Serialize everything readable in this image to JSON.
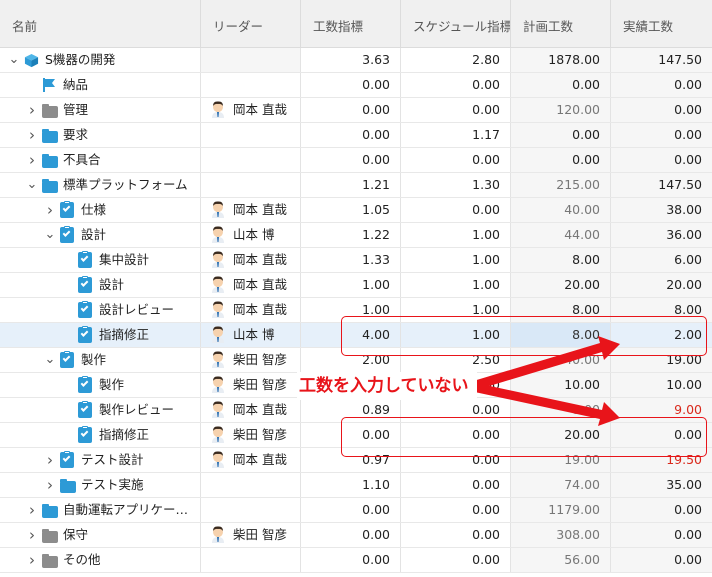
{
  "columns": {
    "name": "名前",
    "leader": "リーダー",
    "kosu_index": "工数指標",
    "schedule_index": "スケジュール指標",
    "planned": "計画工数",
    "actual": "実績工数"
  },
  "rows": [
    {
      "name": "S機器の開発",
      "icon": "package-icon",
      "toggle": "expanded",
      "leader": "",
      "kosu": "3.63",
      "schedule": "2.80",
      "planned": "1878.00",
      "actual": "147.50"
    },
    {
      "name": "納品",
      "icon": "flag-icon",
      "toggle": "",
      "leader": "",
      "kosu": "0.00",
      "schedule": "0.00",
      "planned": "0.00",
      "actual": "0.00"
    },
    {
      "name": "管理",
      "icon": "folder-gray-icon",
      "toggle": "collapsed",
      "leader": "岡本 直哉",
      "kosu": "0.00",
      "schedule": "0.00",
      "planned": "120.00",
      "actual": "0.00"
    },
    {
      "name": "要求",
      "icon": "folder-blue-icon",
      "toggle": "collapsed",
      "leader": "",
      "kosu": "0.00",
      "schedule": "1.17",
      "planned": "0.00",
      "actual": "0.00"
    },
    {
      "name": "不具合",
      "icon": "folder-blue-icon",
      "toggle": "collapsed",
      "leader": "",
      "kosu": "0.00",
      "schedule": "0.00",
      "planned": "0.00",
      "actual": "0.00"
    },
    {
      "name": "標準プラットフォーム",
      "icon": "folder-blue-icon",
      "toggle": "expanded",
      "leader": "",
      "kosu": "1.21",
      "schedule": "1.30",
      "planned": "215.00",
      "actual": "147.50"
    },
    {
      "name": "仕様",
      "icon": "task-icon",
      "toggle": "collapsed",
      "leader": "岡本 直哉",
      "kosu": "1.05",
      "schedule": "0.00",
      "planned": "40.00",
      "actual": "38.00"
    },
    {
      "name": "設計",
      "icon": "task-icon",
      "toggle": "expanded",
      "leader": "山本 博",
      "kosu": "1.22",
      "schedule": "1.00",
      "planned": "44.00",
      "actual": "36.00"
    },
    {
      "name": "集中設計",
      "icon": "task-icon",
      "toggle": "",
      "leader": "岡本 直哉",
      "kosu": "1.33",
      "schedule": "1.00",
      "planned": "8.00",
      "actual": "6.00"
    },
    {
      "name": "設計",
      "icon": "task-icon",
      "toggle": "",
      "leader": "岡本 直哉",
      "kosu": "1.00",
      "schedule": "1.00",
      "planned": "20.00",
      "actual": "20.00"
    },
    {
      "name": "設計レビュー",
      "icon": "task-icon",
      "toggle": "",
      "leader": "岡本 直哉",
      "kosu": "1.00",
      "schedule": "1.00",
      "planned": "8.00",
      "actual": "8.00"
    },
    {
      "name": "指摘修正",
      "icon": "task-icon",
      "toggle": "",
      "leader": "山本 博",
      "kosu": "4.00",
      "schedule": "1.00",
      "planned": "8.00",
      "actual": "2.00"
    },
    {
      "name": "製作",
      "icon": "task-icon",
      "toggle": "expanded",
      "leader": "柴田 智彦",
      "kosu": "2.00",
      "schedule": "2.50",
      "planned": "40.00",
      "actual": "19.00"
    },
    {
      "name": "製作",
      "icon": "task-icon",
      "toggle": "",
      "leader": "柴田 智彦",
      "kosu": "1.00",
      "schedule": "1.00",
      "planned": "10.00",
      "actual": "10.00"
    },
    {
      "name": "製作レビュー",
      "icon": "task-icon",
      "toggle": "",
      "leader": "岡本 直哉",
      "kosu": "0.89",
      "schedule": "0.00",
      "planned": "8.00",
      "actual": "9.00"
    },
    {
      "name": "指摘修正",
      "icon": "task-icon",
      "toggle": "",
      "leader": "柴田 智彦",
      "kosu": "0.00",
      "schedule": "0.00",
      "planned": "20.00",
      "actual": "0.00"
    },
    {
      "name": "テスト設計",
      "icon": "task-icon",
      "toggle": "collapsed",
      "leader": "岡本 直哉",
      "kosu": "0.97",
      "schedule": "0.00",
      "planned": "19.00",
      "actual": "19.50"
    },
    {
      "name": "テスト実施",
      "icon": "folder-blue-icon",
      "toggle": "collapsed",
      "leader": "",
      "kosu": "1.10",
      "schedule": "0.00",
      "planned": "74.00",
      "actual": "35.00"
    },
    {
      "name": "自動運転アプリケー…",
      "icon": "folder-blue-icon",
      "toggle": "collapsed",
      "leader": "",
      "kosu": "0.00",
      "schedule": "0.00",
      "planned": "1179.00",
      "actual": "0.00"
    },
    {
      "name": "保守",
      "icon": "folder-gray-icon",
      "toggle": "collapsed",
      "leader": "柴田 智彦",
      "kosu": "0.00",
      "schedule": "0.00",
      "planned": "308.00",
      "actual": "0.00"
    },
    {
      "name": "その他",
      "icon": "folder-gray-icon",
      "toggle": "collapsed",
      "leader": "",
      "kosu": "0.00",
      "schedule": "0.00",
      "planned": "56.00",
      "actual": "0.00"
    }
  ],
  "annotation": {
    "text": "工数を入力していない",
    "color": "#e8141a"
  },
  "colors": {
    "accent_blue": "#2d9ad6",
    "selected_row": "#e6f0fa",
    "over_budget_red": "#d9291c"
  }
}
